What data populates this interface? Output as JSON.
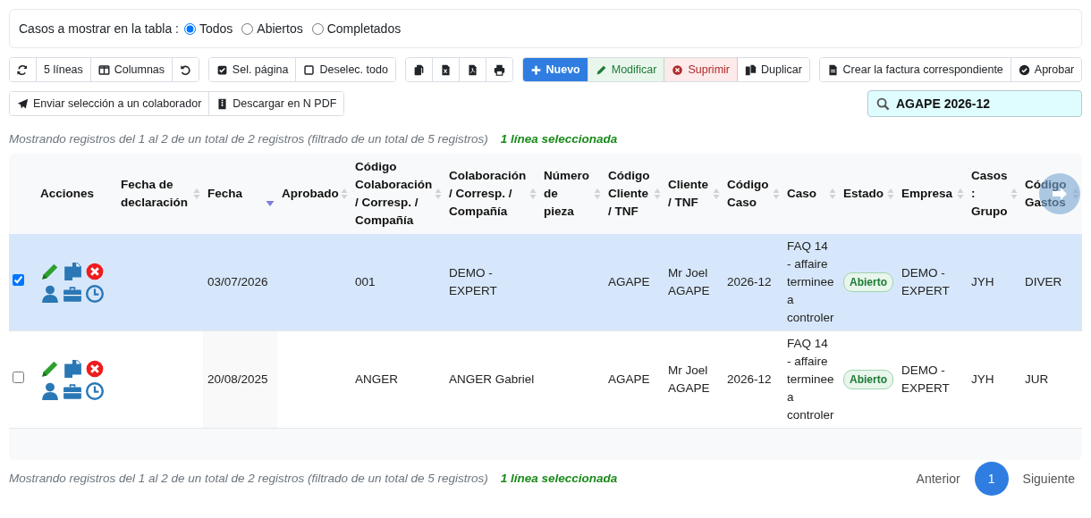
{
  "filter": {
    "label": "Casos a mostrar en la tabla :",
    "options": [
      {
        "label": "Todos",
        "selected": true
      },
      {
        "label": "Abiertos",
        "selected": false
      },
      {
        "label": "Completados",
        "selected": false
      }
    ]
  },
  "toolbar": {
    "rows": [
      {
        "groups": [
          [
            {
              "kind": "refresh"
            },
            {
              "label": "5 líneas",
              "kind": "length"
            },
            {
              "kind": "columns",
              "label": "Columnas"
            },
            {
              "kind": "undo"
            }
          ],
          [
            {
              "kind": "selectpage",
              "label": "Sel. página"
            },
            {
              "kind": "deselect",
              "label": "Deselec. todo"
            }
          ],
          [
            {
              "kind": "copy"
            },
            {
              "kind": "excel"
            },
            {
              "kind": "pdf"
            },
            {
              "kind": "print"
            }
          ],
          [
            {
              "kind": "new",
              "label": "Nuevo"
            },
            {
              "kind": "edit",
              "label": "Modificar"
            },
            {
              "kind": "delete",
              "label": "Suprimir"
            },
            {
              "kind": "duplicate",
              "label": "Duplicar"
            }
          ],
          [
            {
              "kind": "invoice",
              "label": "Crear la factura correspondiente"
            },
            {
              "kind": "approve",
              "label": "Aprobar"
            }
          ]
        ]
      },
      {
        "groups": [
          [
            {
              "kind": "send",
              "label": "Enviar selección a un colaborador"
            },
            {
              "kind": "download",
              "label": "Descargar en N PDF"
            }
          ]
        ]
      }
    ]
  },
  "search": {
    "value": "AGAPE 2026-12"
  },
  "info_top": {
    "text": "Mostrando registros del 1 al 2 de un total de 2 registros (filtrado de un total de 5 registros)",
    "selection": "1 línea seleccionada"
  },
  "table": {
    "columns": [
      {
        "label": "Acciones",
        "kind": "actions"
      },
      {
        "label": "Fecha de declaración",
        "sorted": false
      },
      {
        "label": "Fecha",
        "sorted": true
      },
      {
        "label": "Aprobado",
        "sorted": false
      },
      {
        "label": "Código Colaboración / Corresp. / Compañía",
        "sorted": false
      },
      {
        "label": "Colaboración / Corresp. / Compañía",
        "sorted": false
      },
      {
        "label": "Número de pieza",
        "sorted": false
      },
      {
        "label": "Código Cliente / TNF",
        "sorted": false
      },
      {
        "label": "Cliente / TNF",
        "sorted": false
      },
      {
        "label": "Código Caso",
        "sorted": false
      },
      {
        "label": "Caso",
        "sorted": false
      },
      {
        "label": "Estado",
        "sorted": false,
        "kind": "badge"
      },
      {
        "label": "Empresa",
        "sorted": false
      },
      {
        "label": "Casos : Grupo",
        "sorted": false
      },
      {
        "label": "Código Gastos",
        "sorted": false
      }
    ],
    "rows": [
      {
        "selected": true,
        "checked": true,
        "date": "03/07/2026",
        "collaboration_code": "001",
        "collaboration": "DEMO - EXPERT",
        "client_code": "AGAPE",
        "client": "Mr Joel AGAPE",
        "case_code": "2026-12",
        "case": "FAQ 14 - affaire terminee a controler",
        "status": "Abierto",
        "company": "DEMO - EXPERT",
        "group": "JYH",
        "expense_code": "DIVER"
      },
      {
        "selected": false,
        "checked": false,
        "date": "20/08/2025",
        "collaboration_code": "ANGER",
        "collaboration": "ANGER Gabriel",
        "client_code": "AGAPE",
        "client": "Mr Joel AGAPE",
        "case_code": "2026-12",
        "case": "FAQ 14 - affaire terminee a controler",
        "status": "Abierto",
        "company": "DEMO - EXPERT",
        "group": "JYH",
        "expense_code": "JUR"
      }
    ]
  },
  "info_bottom": {
    "text": "Mostrando registros del 1 al 2 de un total de 2 registros (filtrado de un total de 5 registros)",
    "selection": "1 línea seleccionada"
  },
  "pagination": {
    "previous": "Anterior",
    "pages": [
      {
        "label": "1",
        "selected": true
      }
    ],
    "next": "Siguiente"
  }
}
